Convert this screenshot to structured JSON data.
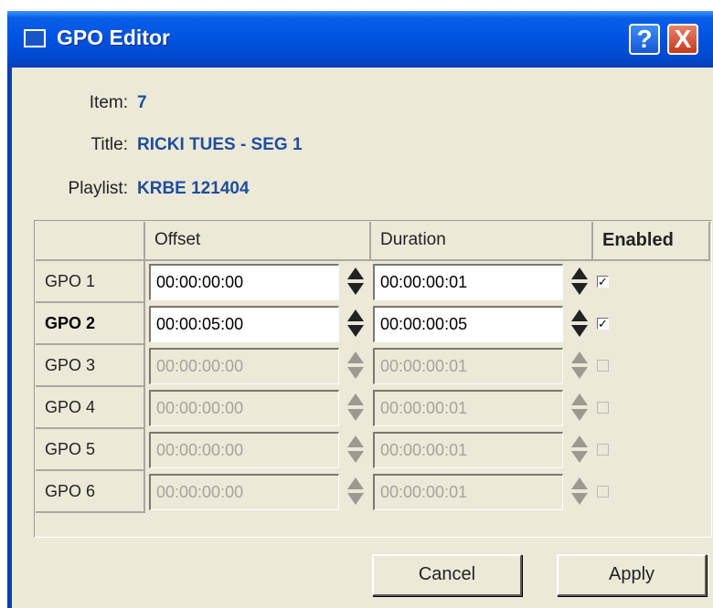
{
  "window": {
    "title": "GPO Editor",
    "help": "?",
    "close": "X"
  },
  "info": {
    "item_label": "Item:",
    "item_value": "7",
    "title_label": "Title:",
    "title_value": "RICKI TUES - SEG 1",
    "playlist_label": "Playlist:",
    "playlist_value": "KRBE 121404"
  },
  "grid": {
    "columns": {
      "offset": "Offset",
      "duration": "Duration",
      "enabled": "Enabled"
    },
    "rows": [
      {
        "name": "GPO 1",
        "offset": "00:00:00:00",
        "duration": "00:00:00:01",
        "enabled": true,
        "active": true
      },
      {
        "name": "GPO 2",
        "offset": "00:00:05:00",
        "duration": "00:00:00:05",
        "enabled": true,
        "active": true
      },
      {
        "name": "GPO 3",
        "offset": "00:00:00:00",
        "duration": "00:00:00:01",
        "enabled": false,
        "active": false
      },
      {
        "name": "GPO 4",
        "offset": "00:00:00:00",
        "duration": "00:00:00:01",
        "enabled": false,
        "active": false
      },
      {
        "name": "GPO 5",
        "offset": "00:00:00:00",
        "duration": "00:00:00:01",
        "enabled": false,
        "active": false
      },
      {
        "name": "GPO 6",
        "offset": "00:00:00:00",
        "duration": "00:00:00:01",
        "enabled": false,
        "active": false
      }
    ]
  },
  "buttons": {
    "cancel": "Cancel",
    "apply": "Apply"
  },
  "colors": {
    "titlebar": "#0054e3",
    "value_text": "#1f4e9c",
    "dialog_bg": "#ece9d8",
    "close_button": "#c63a1c"
  }
}
